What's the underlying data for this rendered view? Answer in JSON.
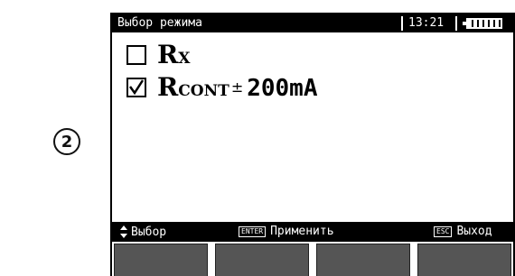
{
  "step": {
    "number": "2"
  },
  "titlebar": {
    "title": "Выбор режима",
    "time": "13:21",
    "battery_icon": "battery-icon"
  },
  "options": [
    {
      "symbol": "R",
      "subscript": "X",
      "checked": false
    },
    {
      "symbol": "R",
      "subscript": "CONT",
      "plusminus": "±",
      "value": "200mA",
      "checked": true
    }
  ],
  "hints": {
    "select_label": "Выбор",
    "enter_key": "ENTER",
    "apply_label": "Применить",
    "esc_key": "ESC",
    "exit_label": "Выход"
  },
  "colors": {
    "bar_background": "#000000",
    "softkey": "#555555"
  }
}
